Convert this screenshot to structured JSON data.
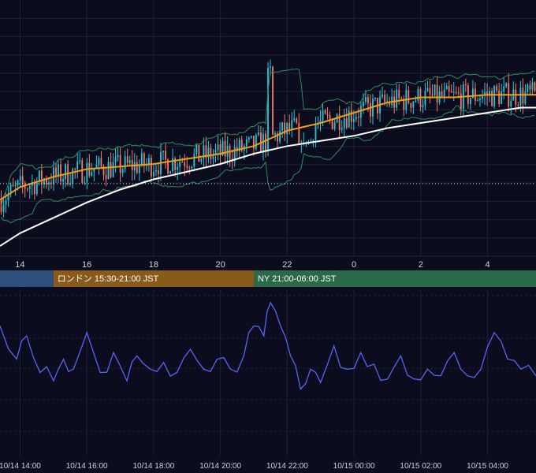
{
  "colors": {
    "background": "#0b0d1f",
    "grid": "#1f2236",
    "up_candle": "#26c6da",
    "down_candle": "#ef7b66",
    "bollinger": "#2e8b57",
    "ma_short": "#f39c12",
    "ma_long": "#ffffff",
    "indicator": "#5865f2",
    "tokyo_session": "#2c4f7c",
    "london_session": "#8a5a1a",
    "ny_session": "#2a6a48"
  },
  "sessions": [
    {
      "label": "",
      "start": 12.0,
      "end": 15.0
    },
    {
      "label": "ロンドン 15:30-21:00 JST",
      "start": 15.0,
      "end": 21.0
    },
    {
      "label": "NY 21:00-06:00 JST",
      "start": 21.0,
      "end": 28.0
    }
  ],
  "chart_data": [
    {
      "type": "candlestick",
      "title": "",
      "x_ticks": [
        "14",
        "16",
        "18",
        "20",
        "22",
        "0",
        "2",
        "4"
      ],
      "x_range_hours": [
        13.4,
        29.45
      ],
      "y_range": [
        0,
        100
      ],
      "grid": true,
      "dotted_reference_level": 28.3,
      "series": [
        {
          "name": "",
          "kind": "line",
          "x": [
            13.4,
            14,
            15,
            16,
            17,
            18,
            19,
            20,
            21,
            22,
            23,
            24,
            25,
            26,
            27,
            28,
            29,
            29.45
          ],
          "values": [
            4,
            9,
            15,
            21,
            26,
            30,
            33,
            36,
            40,
            43,
            45,
            47,
            50,
            52,
            54,
            56,
            58,
            58
          ]
        },
        {
          "name": "",
          "kind": "line",
          "x": [
            13.4,
            14,
            15,
            16,
            17,
            18,
            19,
            20,
            21,
            22,
            23,
            24,
            25,
            26,
            27,
            28,
            29,
            29.45
          ],
          "values": [
            22,
            27,
            31,
            34,
            35,
            36,
            38,
            40,
            43,
            49,
            52,
            56,
            60,
            62,
            62,
            63,
            63,
            63
          ]
        }
      ]
    },
    {
      "type": "line",
      "title": "",
      "x_ticks": [
        "10/14 14:00",
        "10/14 16:00",
        "10/14 18:00",
        "10/14 20:00",
        "10/14 22:00",
        "10/15 00:00",
        "10/15 02:00",
        "10/15 04:00"
      ],
      "y_range": [
        0,
        100
      ],
      "grid": true,
      "series": [
        {
          "name": "",
          "x": [
            13.4,
            13.9,
            14.2,
            14.6,
            15.0,
            15.3,
            15.6,
            16.0,
            16.4,
            16.8,
            17.2,
            17.5,
            17.9,
            18.3,
            18.7,
            19.1,
            19.5,
            19.9,
            20.3,
            20.7,
            21.0,
            21.3,
            21.5,
            21.8,
            22.1,
            22.4,
            22.7,
            23.0,
            23.4,
            23.8,
            24.2,
            24.6,
            25.0,
            25.4,
            25.8,
            26.2,
            26.6,
            27.0,
            27.4,
            27.8,
            28.2,
            28.6,
            29.0,
            29.45
          ],
          "values": [
            78,
            58,
            72,
            50,
            45,
            58,
            52,
            74,
            50,
            62,
            45,
            60,
            52,
            56,
            50,
            64,
            52,
            58,
            52,
            60,
            78,
            72,
            92,
            78,
            60,
            40,
            52,
            44,
            66,
            52,
            62,
            55,
            46,
            60,
            46,
            52,
            48,
            62,
            48,
            52,
            74,
            58,
            52,
            48
          ]
        }
      ]
    }
  ]
}
